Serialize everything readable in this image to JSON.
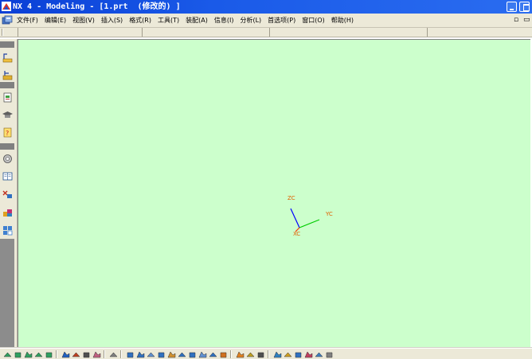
{
  "window": {
    "title": "NX 4 - Modeling - [1.prt  (修改的) ]"
  },
  "menubar": {
    "items": [
      {
        "label": "文件(F)"
      },
      {
        "label": "编辑(E)"
      },
      {
        "label": "视图(V)"
      },
      {
        "label": "插入(S)"
      },
      {
        "label": "格式(R)"
      },
      {
        "label": "工具(T)"
      },
      {
        "label": "装配(A)"
      },
      {
        "label": "信息(I)"
      },
      {
        "label": "分析(L)"
      },
      {
        "label": "首选项(P)"
      },
      {
        "label": "窗口(O)"
      },
      {
        "label": "帮助(H)"
      }
    ],
    "restore_glyph": "▫",
    "close_glyph": "▭"
  },
  "triad": {
    "z_label": "ZC",
    "y_label": "YC",
    "x_label": "XC",
    "colors": {
      "z": "#0000ff",
      "y": "#00cc00",
      "x": "#ff3300"
    }
  },
  "colors": {
    "graphics_background": "#ccffcc",
    "titlebar": "#0a3fd6",
    "menubar": "#ece9d8"
  },
  "left_toolbar": {
    "tools": [
      "sketch-icon",
      "feature-icon",
      "document-icon",
      "graduation-cap-icon",
      "notes-icon",
      "settings-icon",
      "book-icon",
      "assembly-icon",
      "parts-icon",
      "layout-icon"
    ]
  },
  "bottom_toolbar": {
    "tools": [
      "view-icon",
      "view-icon",
      "view-icon",
      "view-icon",
      "view-icon",
      "point-icon",
      "edit-icon",
      "rotate-icon",
      "curve-icon",
      "curve-icon",
      "sketch-icon",
      "sketch-icon",
      "sketch-icon",
      "sketch-icon",
      "sketch-icon",
      "sketch-icon",
      "extrude-icon",
      "extrude-icon",
      "extrude-icon",
      "extrude-icon",
      "tool-icon",
      "tool-icon",
      "tool-icon",
      "analysis-icon",
      "analysis-icon",
      "analysis-icon",
      "analysis-icon",
      "analysis-icon",
      "analysis-icon"
    ]
  }
}
